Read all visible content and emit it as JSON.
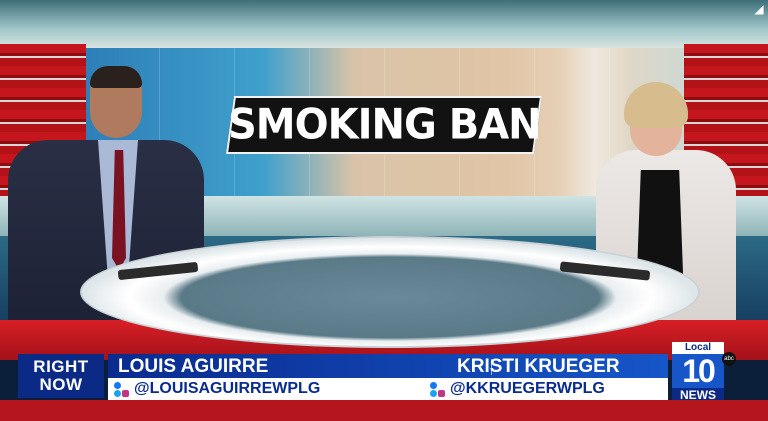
{
  "headline": "SMOKING BAN",
  "lower_third": {
    "tag_line1": "RIGHT",
    "tag_line2": "NOW",
    "anchor_left_name": "LOUIS AGUIRRE",
    "anchor_left_handle": "@LOUISAGUIRREWPLG",
    "anchor_right_name": "KRISTI KRUEGER",
    "anchor_right_handle": "@KKRUEGERWPLG"
  },
  "logo": {
    "top": "Local",
    "number": "10",
    "bottom": "NEWS",
    "network": "abc"
  },
  "icons": {
    "corner": "expand-corner-icon",
    "social": [
      "twitter-icon",
      "facebook-icon",
      "instagram-icon"
    ]
  },
  "colors": {
    "brand_blue": "#0b2a86",
    "accent_blue": "#1656c8",
    "brand_red": "#b5151c",
    "headline_bg": "#121212"
  }
}
